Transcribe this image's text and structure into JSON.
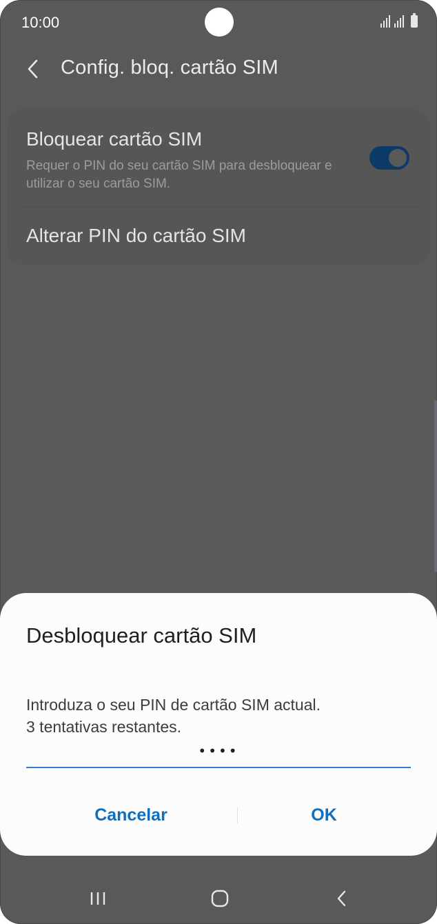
{
  "status_bar": {
    "time": "10:00",
    "icons": [
      "signal-icon",
      "signal-icon",
      "battery-icon"
    ]
  },
  "app_bar": {
    "back_icon": "chevron-left-icon",
    "title": "Config. bloq. cartão SIM"
  },
  "settings": {
    "lock_sim": {
      "title": "Bloquear cartão SIM",
      "summary": "Requer o PIN do seu cartão SIM para desbloquear e utilizar o seu cartão SIM.",
      "enabled": true
    },
    "change_pin": {
      "title": "Alterar PIN do cartão SIM"
    }
  },
  "dialog": {
    "title": "Desbloquear cartão SIM",
    "message_line1": "Introduza o seu PIN de cartão SIM actual.",
    "message_line2": "3 tentativas restantes.",
    "pin_value": "••••",
    "cancel_label": "Cancelar",
    "ok_label": "OK"
  },
  "nav_bar": {
    "icons": [
      "recents-icon",
      "home-icon",
      "back-icon"
    ]
  },
  "colors": {
    "scrim": "#595959",
    "accent": "#0e6fbf",
    "toggle_on": "#0b3b66"
  }
}
